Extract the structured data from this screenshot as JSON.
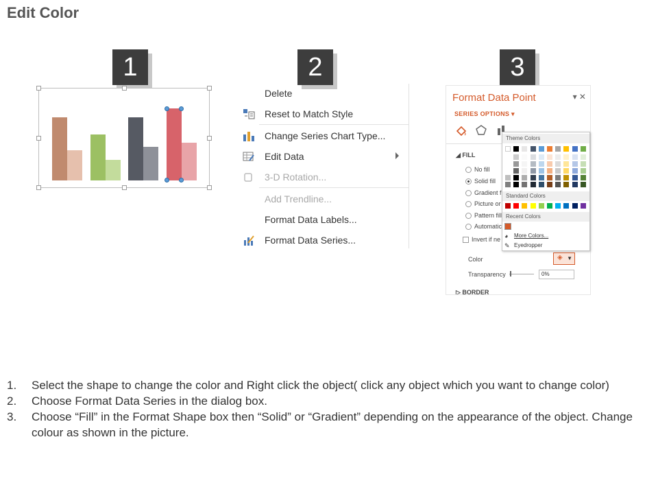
{
  "title": "Edit Color",
  "steps_badges": [
    "1",
    "2",
    "3"
  ],
  "chart_colors": {
    "s1": [
      "#c08a6e",
      "#e6c0ad"
    ],
    "s2": [
      "#9cc063",
      "#c3dc9c"
    ],
    "s3": [
      "#565a63",
      "#8e9199"
    ],
    "s4": [
      "#d7636a",
      "#e8a4a8"
    ]
  },
  "context_menu": {
    "items": [
      {
        "label": "Delete",
        "icon": "none",
        "disabled": false
      },
      {
        "label": "Reset to Match Style",
        "icon": "reset-style-icon",
        "disabled": false
      },
      {
        "label": "Change Series Chart Type...",
        "icon": "chart-type-icon",
        "disabled": false
      },
      {
        "label": "Edit Data",
        "icon": "edit-data-icon",
        "disabled": false
      },
      {
        "label": "3-D Rotation...",
        "icon": "rotation-3d-icon",
        "disabled": true
      },
      {
        "label": "Add Trendline...",
        "icon": "none",
        "disabled": true
      },
      {
        "label": "Format Data Labels...",
        "icon": "none",
        "disabled": false
      },
      {
        "label": "Format Data Series...",
        "icon": "format-series-icon",
        "disabled": false
      }
    ]
  },
  "format_pane": {
    "title": "Format Data Point",
    "series_options": "SERIES OPTIONS",
    "fill_section": "FILL",
    "border_section": "BORDER",
    "fill_options": [
      "No fill",
      "Solid fill",
      "Gradient fi",
      "Picture or",
      "Pattern fill",
      "Automatic"
    ],
    "invert": "Invert if ne",
    "color_label": "Color",
    "transparency_label": "Transparency",
    "transparency_value": "0%"
  },
  "palette": {
    "theme_header": "Theme Colors",
    "standard_header": "Standard Colors",
    "recent_header": "Recent Colors",
    "more_colors": "More Colors...",
    "eyedropper": "Eyedropper",
    "theme_top": [
      "#ffffff",
      "#000000",
      "#e7e6e6",
      "#44546a",
      "#5b9bd5",
      "#ed7d31",
      "#a5a5a5",
      "#ffc000",
      "#4472c4",
      "#70ad47"
    ],
    "standard": [
      "#c00000",
      "#ff0000",
      "#ffc000",
      "#ffff00",
      "#92d050",
      "#00b050",
      "#00b0f0",
      "#0070c0",
      "#002060",
      "#7030a0"
    ],
    "recent": [
      "#d45a2a"
    ]
  },
  "instructions": [
    {
      "num": "1.",
      "text": "Select the shape to change the color and Right click the object( click any object which you want to change color)"
    },
    {
      "num": "2.",
      "text": "Choose Format Data Series in the dialog box."
    },
    {
      "num": "3.",
      "text": "Choose “Fill” in the Format Shape box then “Solid” or “Gradient” depending on the appearance of the object. Change colour as shown in the picture."
    }
  ]
}
